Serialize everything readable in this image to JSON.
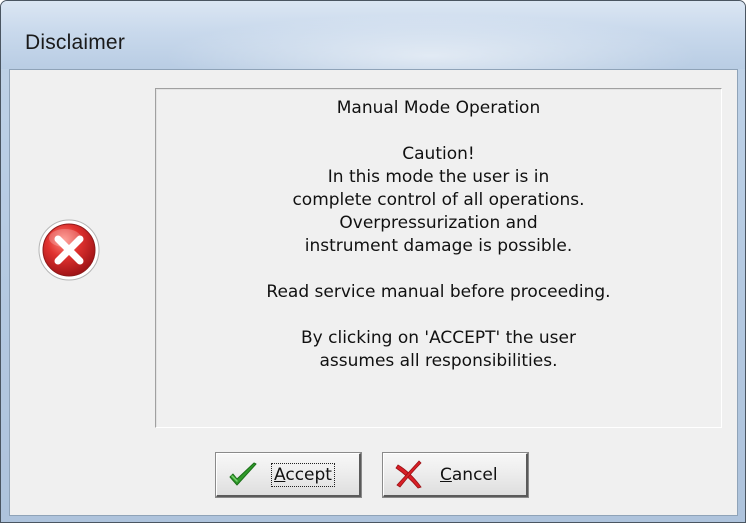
{
  "window": {
    "title": "Disclaimer"
  },
  "message": {
    "lines": [
      "Manual Mode Operation",
      "",
      "Caution!",
      "In this mode the user is in",
      "complete control of all operations.",
      "Overpressurization and",
      "instrument damage is possible.",
      "",
      "Read service manual before proceeding.",
      "",
      "By clicking on 'ACCEPT' the user",
      "assumes all responsibilities."
    ]
  },
  "icons": {
    "status": "error-icon",
    "accept": "checkmark-icon",
    "cancel": "x-mark-icon"
  },
  "colors": {
    "error_red": "#d9262b",
    "check_green": "#2f9a2a",
    "cancel_red": "#d81f26"
  },
  "buttons": {
    "accept": {
      "mnemonic": "A",
      "rest": "ccept"
    },
    "cancel": {
      "mnemonic": "C",
      "rest": "ancel"
    }
  }
}
